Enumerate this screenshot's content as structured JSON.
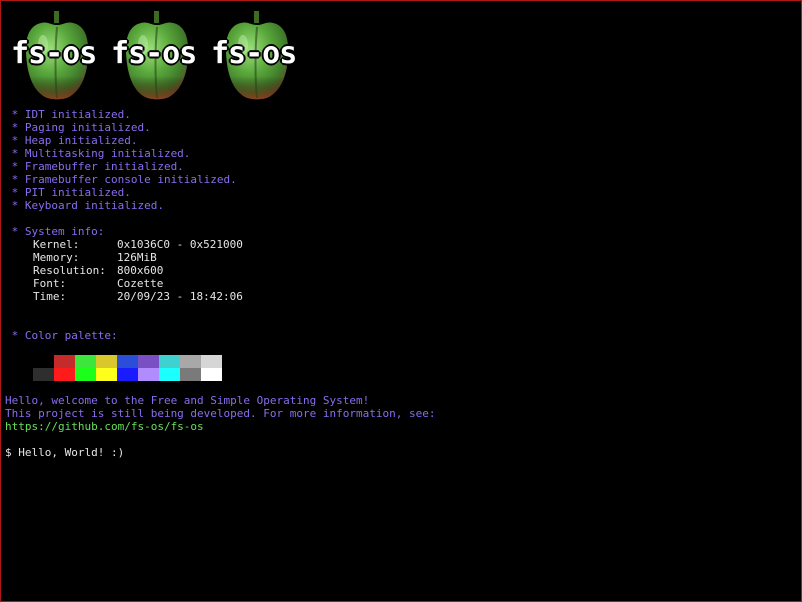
{
  "logo": {
    "count": 3,
    "text": "fs-os"
  },
  "boot_log": [
    " * IDT initialized.",
    " * Paging initialized.",
    " * Heap initialized.",
    " * Multitasking initialized.",
    " * Framebuffer initialized.",
    " * Framebuffer console initialized.",
    " * PIT initialized.",
    " * Keyboard initialized."
  ],
  "system_info": {
    "heading": " * System info:",
    "rows": [
      {
        "label": "Kernel:",
        "value": "0x1036C0 - 0x521000"
      },
      {
        "label": "Memory:",
        "value": "126MiB"
      },
      {
        "label": "Resolution:",
        "value": "800x600"
      },
      {
        "label": "Font:",
        "value": "Cozette"
      },
      {
        "label": "Time:",
        "value": "20/09/23 - 18:42:06"
      }
    ]
  },
  "palette": {
    "heading": " * Color palette:",
    "normal": [
      "#000000",
      "#c42b2b",
      "#3ce63c",
      "#d9c72b",
      "#2b4ed9",
      "#7b4fc4",
      "#3fd0d0",
      "#a8a8a8",
      "#d6d6d6"
    ],
    "bright": [
      "#2e2e2e",
      "#ff1b1b",
      "#1bff1b",
      "#ffff1b",
      "#1b1bff",
      "#b08cff",
      "#1bffff",
      "#7a7a7a",
      "#ffffff"
    ]
  },
  "welcome": {
    "line1": "Hello, welcome to the Free and Simple Operating System!",
    "line2": "This project is still being developed. For more information, see:",
    "link": "https://github.com/fs-os/fs-os"
  },
  "shell": {
    "prompt_line": "$ Hello, World! :)"
  },
  "colors": {
    "log_text": "#8a6cf0",
    "info_text": "#e6e6e6",
    "link_text": "#66e05a",
    "border": "#b01818"
  }
}
